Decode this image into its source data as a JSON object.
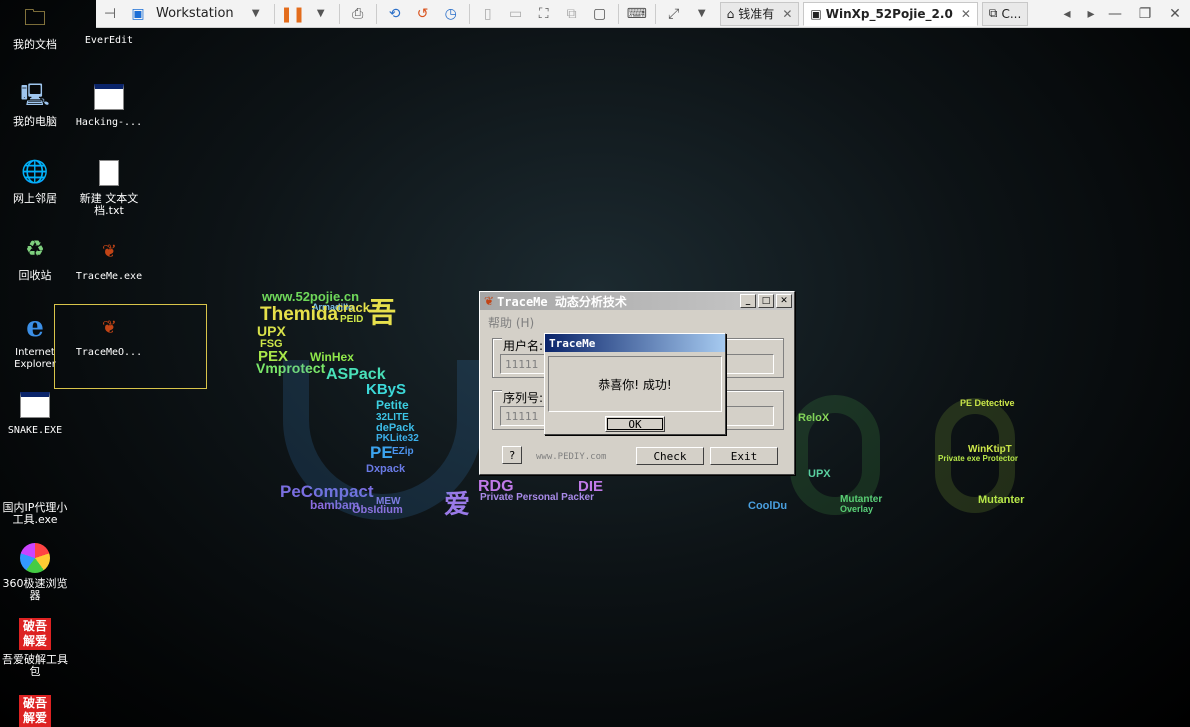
{
  "toolbar": {
    "workstation_label": "Workstation",
    "tabs": [
      {
        "label": "钱准有",
        "active": false
      },
      {
        "label": "WinXp_52Pojie_2.0",
        "active": true
      },
      {
        "label": "C...",
        "active": false
      }
    ]
  },
  "desktop_icons": [
    {
      "label": "我的文档"
    },
    {
      "label": "EverEdit"
    },
    {
      "label": "我的电脑"
    },
    {
      "label": "Hacking-..."
    },
    {
      "label": "网上邻居"
    },
    {
      "label": "新建 文本文档.txt"
    },
    {
      "label": "回收站"
    },
    {
      "label": "TraceMe.exe"
    },
    {
      "label": "Internet Explorer"
    },
    {
      "label": "TraceMeO..."
    },
    {
      "label": "SNAKE.EXE"
    },
    {
      "label": "国内IP代理小工具.exe"
    },
    {
      "label": "360极速浏览器"
    },
    {
      "label": "吾爱破解工具包"
    }
  ],
  "traceme": {
    "title": "TraceMe 动态分析技术",
    "menu_help": "帮助 (H)",
    "username_label": "用户名:",
    "serial_label": "序列号:",
    "username_value": "11111",
    "serial_value": "11111",
    "help_btn": "?",
    "footer_text": "www.PEDIY.com",
    "check_btn": "Check",
    "exit_btn": "Exit"
  },
  "msgbox": {
    "title": "TraceMe",
    "message": "恭喜你! 成功!",
    "ok_btn": "OK"
  },
  "wallpaper": {
    "words": [
      "www.52pojie.cn",
      "Armadillo",
      "crack",
      "Themida",
      "PEID",
      "吾",
      "UPX",
      "FSG",
      "PEX",
      "WinHex",
      "Vmprotect",
      "ASPack",
      "KByS",
      "Petite",
      "32LITE",
      "dePack",
      "PKLite32",
      "PE",
      "EZip",
      "Dxpack",
      "PeCompact",
      "bambam",
      "ObsIdium",
      "MEW",
      "RDG",
      "DIE",
      "Private Personal Packer",
      "爱",
      "ReloX",
      "UPX",
      "Mutanter",
      "Overlay",
      "CoolDu",
      "PE Detective",
      "WinKtipT",
      "Private exe Protector",
      "Mutanter"
    ]
  }
}
